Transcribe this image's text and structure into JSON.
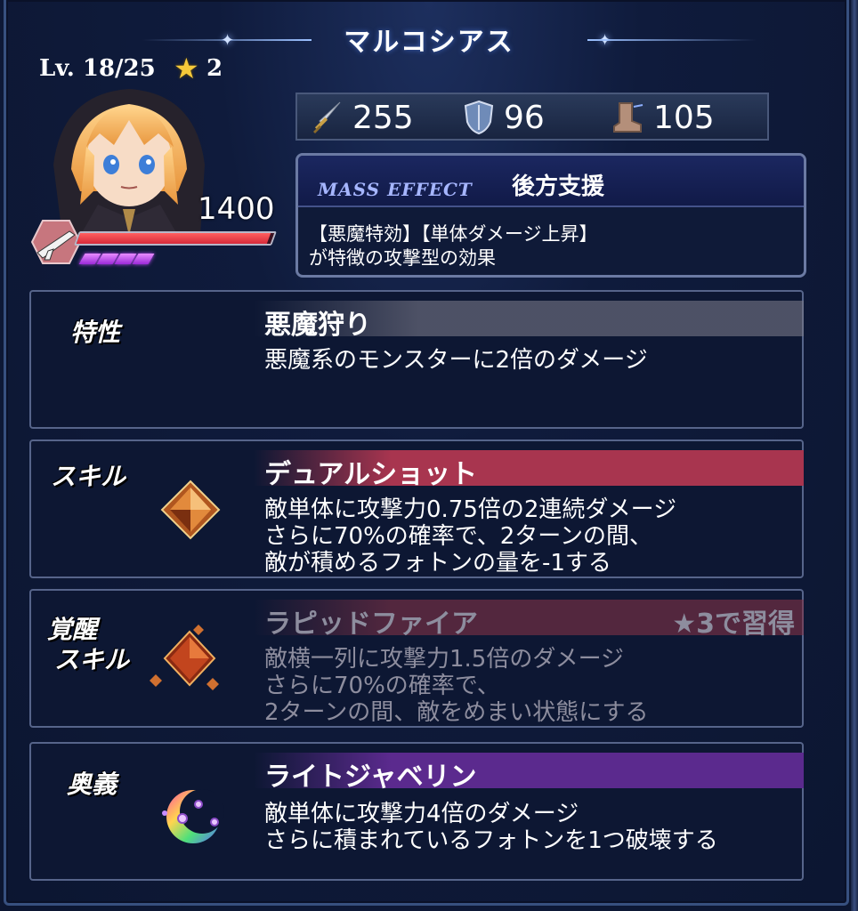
{
  "header": {
    "title": "マルコシアス",
    "level_label": "Lv. 18/25",
    "rarity": "2",
    "hp": "1400",
    "hp_fraction": 0.98,
    "photon_count": 4
  },
  "stats": {
    "attack": "255",
    "defense": "96",
    "speed": "105",
    "icons": [
      "sword-icon",
      "shield-icon",
      "boot-icon"
    ]
  },
  "mass_effect": {
    "label": "MASS EFFECT",
    "name": "後方支援",
    "desc_line1": "【悪魔特効】【単体ダメージ上昇】",
    "desc_line2": "が特徴の攻撃型の効果"
  },
  "trait": {
    "label": "特性",
    "name": "悪魔狩り",
    "desc": [
      "悪魔系のモンスターに2倍のダメージ"
    ]
  },
  "skill": {
    "label": "スキル",
    "name": "デュアルショット",
    "desc": [
      "敵単体に攻撃力0.75倍の2連続ダメージ",
      "さらに70%の確率で、2ターンの間、",
      "敵が積めるフォトンの量を-1する"
    ]
  },
  "awakened_skill": {
    "label_line1": "覚醒",
    "label_line2": "スキル",
    "name": "ラピッドファイア",
    "unlock": "★3で習得",
    "desc": [
      "敵横一列に攻撃力1.5倍のダメージ",
      "さらに70%の確率で、",
      "2ターンの間、敵をめまい状態にする"
    ]
  },
  "ougi": {
    "label": "奥義",
    "name": "ライトジャベリン",
    "desc": [
      "敵単体に攻撃力4倍のダメージ",
      "さらに積まれているフォトンを1つ破壊する"
    ]
  },
  "colors": {
    "skill_header": "#a8354f",
    "ougi_header": "#5b2a8e",
    "star": "#f5c93a",
    "hp_bar": "#d62a3a",
    "photon": "#c34cff"
  }
}
